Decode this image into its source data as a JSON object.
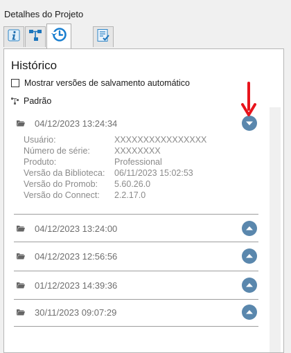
{
  "panel": {
    "title": "Detalhes do Projeto"
  },
  "tabs": [
    {
      "icon": "info-icon"
    },
    {
      "icon": "hierarchy-icon"
    },
    {
      "icon": "history-icon",
      "active": true
    },
    {
      "icon": "checklist-icon"
    }
  ],
  "history": {
    "title": "Histórico",
    "autosave_checkbox": {
      "label": "Mostrar versões de salvamento automático",
      "checked": false
    },
    "root_label": "Padrão",
    "entries": [
      {
        "date": "04/12/2023 13:24:34",
        "expanded": true,
        "details": [
          {
            "key": "Usuário:",
            "value": "XXXXXXXXXXXXXXXX"
          },
          {
            "key": "Número de série:",
            "value": "XXXXXXXX"
          },
          {
            "key": "Produto:",
            "value": "Professional"
          },
          {
            "key": "Versão da Biblioteca:",
            "value": "06/11/2023 15:02:53"
          },
          {
            "key": "Versão do Promob:",
            "value": "5.60.26.0"
          },
          {
            "key": "Versão do Connect:",
            "value": "2.2.17.0"
          }
        ]
      },
      {
        "date": "04/12/2023 13:24:00",
        "expanded": false
      },
      {
        "date": "04/12/2023 12:56:56",
        "expanded": false
      },
      {
        "date": "01/12/2023 14:39:36",
        "expanded": false
      },
      {
        "date": "30/11/2023 09:07:29",
        "expanded": false
      }
    ]
  },
  "colors": {
    "toggle": "#5a87ad",
    "annotation_arrow": "#e8141c",
    "active_tab_icon": "#1a7fd0"
  }
}
